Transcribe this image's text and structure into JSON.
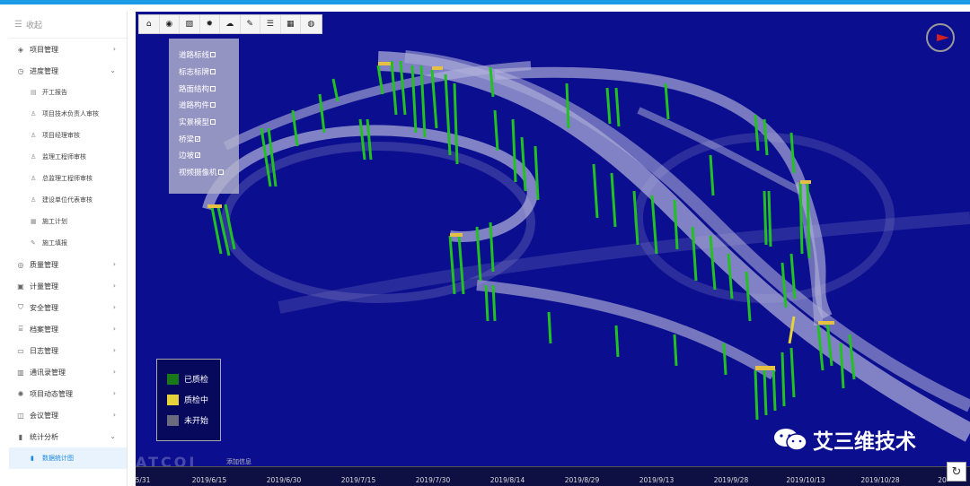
{
  "sidebar": {
    "collapse_label": "收起",
    "menu": [
      {
        "label": "项目管理",
        "chev": "›"
      },
      {
        "label": "进度管理",
        "chev": "⌄"
      },
      {
        "label": "开工报告"
      },
      {
        "label": "项目技术负责人审核"
      },
      {
        "label": "项目经理审核"
      },
      {
        "label": "监理工程师审核"
      },
      {
        "label": "总监理工程师审核"
      },
      {
        "label": "建设单位代表审核"
      },
      {
        "label": "施工计划"
      },
      {
        "label": "施工填报"
      },
      {
        "label": "质量管理",
        "chev": "›"
      },
      {
        "label": "计量管理",
        "chev": "›"
      },
      {
        "label": "安全管理",
        "chev": "›"
      },
      {
        "label": "档案管理",
        "chev": "›"
      },
      {
        "label": "日志管理",
        "chev": "›"
      },
      {
        "label": "通讯录管理",
        "chev": "›"
      },
      {
        "label": "项目动态管理",
        "chev": "›"
      },
      {
        "label": "会议管理",
        "chev": "›"
      },
      {
        "label": "统计分析",
        "chev": "⌄"
      },
      {
        "label": "数据统计图"
      }
    ]
  },
  "toolbar": {
    "buttons": [
      "home-icon",
      "eye-icon",
      "image-icon",
      "sun-icon",
      "cloud-icon",
      "pin-icon",
      "list-icon",
      "table-icon",
      "globe-icon"
    ]
  },
  "layers": {
    "items": [
      {
        "label": "道路标线",
        "mark": ""
      },
      {
        "label": "标志标牌",
        "mark": ""
      },
      {
        "label": "路面结构",
        "mark": ""
      },
      {
        "label": "道路构件",
        "mark": ""
      },
      {
        "label": "实景模型",
        "mark": ""
      },
      {
        "label": "桥梁",
        "mark": "✓"
      },
      {
        "label": "边坡",
        "mark": "✓"
      },
      {
        "label": "视频摄像机",
        "mark": ""
      }
    ]
  },
  "legend": {
    "items": [
      {
        "label": "已质检",
        "color": "#1a7a1a"
      },
      {
        "label": "质检中",
        "color": "#e6d23a"
      },
      {
        "label": "未开始",
        "color": "#6b6b80"
      }
    ]
  },
  "watermark": {
    "text": "艾三维技术"
  },
  "timeline": {
    "brand": "ATCOI",
    "small_label": "添加信息",
    "dates": [
      "5/31",
      "2019/6/15",
      "2019/6/30",
      "2019/7/15",
      "2019/7/30",
      "2019/8/14",
      "2019/8/29",
      "2019/9/13",
      "2019/9/28",
      "2019/10/13",
      "2019/10/28",
      "20"
    ]
  },
  "colors": {
    "accent": "#1e9be6",
    "viewer_bg": "#0b0e8f",
    "pier": "#22c122"
  }
}
